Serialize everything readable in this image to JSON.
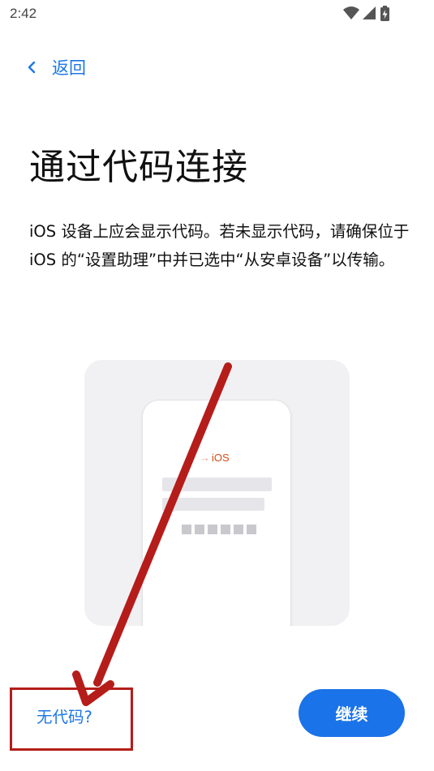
{
  "status_bar": {
    "time": "2:42",
    "icons": [
      "wifi-icon",
      "signal-icon",
      "battery-charging-icon"
    ]
  },
  "nav": {
    "back_label": "返回",
    "back_icon": "chevron-left-icon"
  },
  "page": {
    "title": "通过代码连接",
    "description": "iOS 设备上应会显示代码。若未显示代码，请确保位于 iOS 的“设置助理”中并已选中“从安卓设备”以传输。"
  },
  "illustration": {
    "ios_label": "iOS",
    "code_digits": 6
  },
  "actions": {
    "no_code_label": "无代码?",
    "continue_label": "继续"
  },
  "colors": {
    "accent": "#1a73e8",
    "link": "#1c77e6",
    "annotation": "#b51d1a",
    "ios_orange": "#d84a12"
  }
}
